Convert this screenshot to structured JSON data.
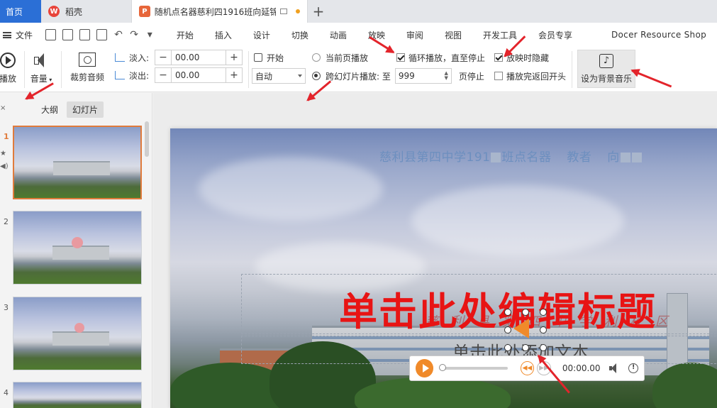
{
  "titlebar": {
    "home_tab": "首页",
    "docer_tab": "稻壳",
    "doc_tab": "随机点名器慈利四1916班向延锦",
    "new_tab_symbol": "+"
  },
  "menubar": {
    "file_label": "文件",
    "items": [
      "开始",
      "插入",
      "设计",
      "切换",
      "动画",
      "放映",
      "审阅",
      "视图",
      "开发工具",
      "会员专享"
    ],
    "docer_shop": "Docer Resource Shop"
  },
  "ribbon": {
    "play_label": "播放",
    "volume_label": "音量",
    "trim_label": "裁剪音频",
    "fade_in_label": "淡入:",
    "fade_in_value": "00.00",
    "fade_out_label": "淡出:",
    "fade_out_value": "00.00",
    "start_label": "开始",
    "start_value": "自动",
    "play_current_label": "当前页播放",
    "play_across_label": "跨幻灯片播放: 至",
    "across_value": "999",
    "page_stop_label": "页停止",
    "loop_label": "循环播放，直至停止",
    "hide_label": "放映时隐藏",
    "rewind_label": "播放完返回开头",
    "bg_music_label": "设为背景音乐",
    "minus": "−",
    "plus": "+"
  },
  "panel": {
    "outline_tab": "大纲",
    "slides_tab": "幻灯片",
    "thumbs": [
      "1",
      "2",
      "3",
      "4"
    ]
  },
  "slide": {
    "header_school": "慈利县第四中学191",
    "header_class": "班点名器",
    "header_teacher": "教者",
    "header_name_part": "向",
    "title_placeholder": "单击此处编辑标题",
    "subtitle_placeholder": "单击此处添加文本",
    "watermark": "慈利县第四中学利校区"
  },
  "player": {
    "time": "00:00.00"
  },
  "colors": {
    "accent_blue": "#2b6fd6",
    "title_red": "#e81414",
    "audio_orange": "#f08a2a",
    "arrow_red": "#e3242b",
    "selection_orange": "#e07b3c"
  }
}
